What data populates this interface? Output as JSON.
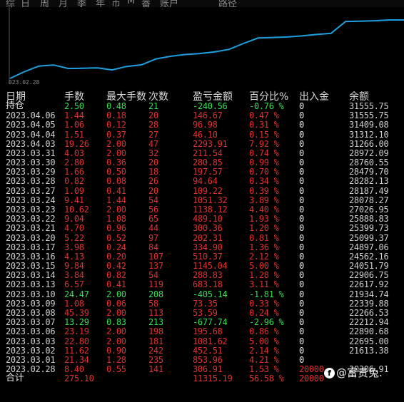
{
  "tabs": [
    "综",
    "日",
    "周",
    "月",
    "季",
    "年",
    "币",
    "M",
    "番",
    "账户",
    "路径"
  ],
  "chart": {
    "start_date": "023.02.28",
    "equity_series": [
      20306.91,
      21613.38,
      22695.0,
      22890.68,
      22212.94,
      22266.53,
      22339.88,
      21934.74,
      22617.92,
      22906.75,
      24051.79,
      24562.16,
      24897.06,
      25099.37,
      25399.73,
      25888.83,
      27026.95,
      28078.27,
      28187.49,
      28282.13,
      28479.7,
      28760.55,
      28972.09,
      31266.0,
      31312.1,
      31409.08,
      31555.75,
      31555.75
    ],
    "line_color": "#1e9fe0"
  },
  "headers": [
    "日期",
    "手数",
    "最大手数",
    "次数",
    "盈亏金额",
    "百分比%",
    "出入金",
    "余额"
  ],
  "hold": {
    "label": "持仓",
    "lots": "2.50",
    "max_lots": "0.48",
    "count": "21",
    "pnl": "-240.56",
    "pct": "-0.76 %",
    "flow": "0",
    "balance": "31555.75"
  },
  "rows": [
    {
      "date": "2023.04.06",
      "lots": "1.44",
      "max_lots": "0.18",
      "count": "20",
      "pnl": "146.67",
      "pct": "0.47 %",
      "flow": "0",
      "balance": "31555.75",
      "sign": "red"
    },
    {
      "date": "2023.04.05",
      "lots": "1.06",
      "max_lots": "0.12",
      "count": "28",
      "pnl": "96.98",
      "pct": "0.31 %",
      "flow": "0",
      "balance": "31409.08",
      "sign": "red"
    },
    {
      "date": "2023.04.04",
      "lots": "1.51",
      "max_lots": "0.37",
      "count": "27",
      "pnl": "46.10",
      "pct": "0.15 %",
      "flow": "0",
      "balance": "31312.10",
      "sign": "red"
    },
    {
      "date": "2023.04.03",
      "lots": "19.26",
      "max_lots": "2.00",
      "count": "47",
      "pnl": "2293.91",
      "pct": "7.92 %",
      "flow": "0",
      "balance": "31266.00",
      "sign": "red"
    },
    {
      "date": "2023.03.31",
      "lots": "4.03",
      "max_lots": "2.00",
      "count": "32",
      "pnl": "211.54",
      "pct": "0.74 %",
      "flow": "0",
      "balance": "28972.09",
      "sign": "red"
    },
    {
      "date": "2023.03.30",
      "lots": "2.80",
      "max_lots": "0.36",
      "count": "20",
      "pnl": "280.85",
      "pct": "0.99 %",
      "flow": "0",
      "balance": "28760.55",
      "sign": "red"
    },
    {
      "date": "2023.03.29",
      "lots": "1.66",
      "max_lots": "0.50",
      "count": "18",
      "pnl": "197.57",
      "pct": "0.70 %",
      "flow": "0",
      "balance": "28479.70",
      "sign": "red"
    },
    {
      "date": "2023.03.28",
      "lots": "0.82",
      "max_lots": "0.08",
      "count": "26",
      "pnl": "94.64",
      "pct": "0.34 %",
      "flow": "0",
      "balance": "28282.13",
      "sign": "red"
    },
    {
      "date": "2023.03.27",
      "lots": "1.09",
      "max_lots": "0.41",
      "count": "20",
      "pnl": "109.22",
      "pct": "0.39 %",
      "flow": "0",
      "balance": "28187.49",
      "sign": "red"
    },
    {
      "date": "2023.03.24",
      "lots": "9.41",
      "max_lots": "1.44",
      "count": "54",
      "pnl": "1051.32",
      "pct": "3.89 %",
      "flow": "0",
      "balance": "28078.27",
      "sign": "red"
    },
    {
      "date": "2023.03.23",
      "lots": "10.62",
      "max_lots": "2.00",
      "count": "56",
      "pnl": "1138.12",
      "pct": "4.40 %",
      "flow": "0",
      "balance": "27026.95",
      "sign": "red"
    },
    {
      "date": "2023.03.22",
      "lots": "9.04",
      "max_lots": "1.08",
      "count": "65",
      "pnl": "489.10",
      "pct": "1.93 %",
      "flow": "0",
      "balance": "25888.83",
      "sign": "red"
    },
    {
      "date": "2023.03.21",
      "lots": "4.70",
      "max_lots": "0.96",
      "count": "44",
      "pnl": "300.36",
      "pct": "1.20 %",
      "flow": "0",
      "balance": "25399.73",
      "sign": "red"
    },
    {
      "date": "2023.03.20",
      "lots": "5.22",
      "max_lots": "0.52",
      "count": "97",
      "pnl": "202.31",
      "pct": "0.81 %",
      "flow": "0",
      "balance": "25099.37",
      "sign": "red"
    },
    {
      "date": "2023.03.17",
      "lots": "3.98",
      "max_lots": "0.24",
      "count": "84",
      "pnl": "334.90",
      "pct": "1.36 %",
      "flow": "0",
      "balance": "24897.06",
      "sign": "red"
    },
    {
      "date": "2023.03.16",
      "lots": "4.13",
      "max_lots": "0.20",
      "count": "107",
      "pnl": "510.37",
      "pct": "2.12 %",
      "flow": "0",
      "balance": "24562.16",
      "sign": "red"
    },
    {
      "date": "2023.03.15",
      "lots": "9.84",
      "max_lots": "0.42",
      "count": "137",
      "pnl": "1145.04",
      "pct": "5.00 %",
      "flow": "0",
      "balance": "24051.79",
      "sign": "red"
    },
    {
      "date": "2023.03.14",
      "lots": "3.84",
      "max_lots": "0.82",
      "count": "54",
      "pnl": "288.83",
      "pct": "1.28 %",
      "flow": "0",
      "balance": "22906.75",
      "sign": "red"
    },
    {
      "date": "2023.03.13",
      "lots": "6.57",
      "max_lots": "0.41",
      "count": "119",
      "pnl": "683.18",
      "pct": "3.11 %",
      "flow": "0",
      "balance": "22617.92",
      "sign": "red"
    },
    {
      "date": "2023.03.10",
      "lots": "24.47",
      "max_lots": "2.00",
      "count": "208",
      "pnl": "-405.14",
      "pct": "-1.81 %",
      "flow": "0",
      "balance": "21934.74",
      "sign": "green"
    },
    {
      "date": "2023.03.09",
      "lots": "1.08",
      "max_lots": "0.06",
      "count": "58",
      "pnl": "73.35",
      "pct": "0.33 %",
      "flow": "0",
      "balance": "22339.88",
      "sign": "red"
    },
    {
      "date": "2023.03.08",
      "lots": "45.39",
      "max_lots": "2.00",
      "count": "113",
      "pnl": "53.59",
      "pct": "0.24 %",
      "flow": "0",
      "balance": "22266.53",
      "sign": "red"
    },
    {
      "date": "2023.03.07",
      "lots": "13.29",
      "max_lots": "0.83",
      "count": "213",
      "pnl": "-677.74",
      "pct": "-2.96 %",
      "flow": "0",
      "balance": "22212.94",
      "sign": "green"
    },
    {
      "date": "2023.03.06",
      "lots": "23.19",
      "max_lots": "2.00",
      "count": "198",
      "pnl": "195.68",
      "pct": "0.86 %",
      "flow": "0",
      "balance": "22890.68",
      "sign": "red"
    },
    {
      "date": "2023.03.03",
      "lots": "22.80",
      "max_lots": "2.00",
      "count": "181",
      "pnl": "1081.62",
      "pct": "5.00 %",
      "flow": "0",
      "balance": "22695.00",
      "sign": "red"
    },
    {
      "date": "2023.03.02",
      "lots": "11.62",
      "max_lots": "0.90",
      "count": "242",
      "pnl": "452.51",
      "pct": "2.14 %",
      "flow": "0",
      "balance": "21613.38",
      "sign": "red"
    },
    {
      "date": "2023.03.01",
      "lots": "21.34",
      "max_lots": "1.28",
      "count": "235",
      "pnl": "853.96",
      "pct": "4.21 %",
      "flow": "0",
      "balance": "",
      "sign": "red"
    },
    {
      "date": "2023.02.28",
      "lots": "8.40",
      "max_lots": "0.55",
      "count": "141",
      "pnl": "306.91",
      "pct": "1.53 %",
      "flow": "20000",
      "balance": "20306.91",
      "sign": "red"
    }
  ],
  "total": {
    "label": "合计",
    "lots": "275.10",
    "pnl": "11315.19",
    "pct": "56.58 %",
    "flow": "20000"
  },
  "watermark": {
    "icon": "f",
    "text": "@富贵兔."
  }
}
